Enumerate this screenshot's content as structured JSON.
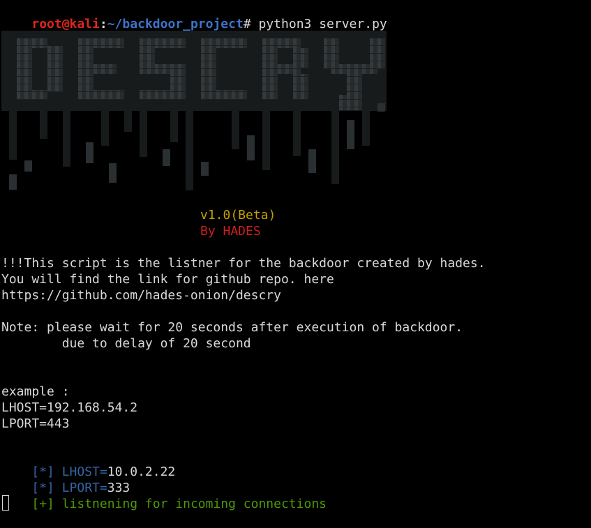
{
  "prompt": {
    "user_host": "root@kali",
    "separator": ":",
    "path": "~/backdoor_project",
    "symbol": "#",
    "command": " python3 server.py"
  },
  "banner": {
    "logo_text": "DESCRY",
    "version": "v1.0(Beta)",
    "author": "By HADES"
  },
  "intro": {
    "line1": "!!!This script is the listner for the backdoor created by hades.",
    "line2": "You will find the link for github repo. here",
    "line3": "https://github.com/hades-onion/descry"
  },
  "note": {
    "line1": "Note: please wait for 20 seconds after execution of backdoor.",
    "line2": "        due to delay of 20 second"
  },
  "example": {
    "header": "example :",
    "lhost": "LHOST=192.168.54.2",
    "lport": "LPORT=443"
  },
  "status": {
    "lhost_marker": "[*]",
    "lhost_key": " LHOST=",
    "lhost_value": "10.0.2.22",
    "lport_marker": "[*]",
    "lport_key": " LPORT=",
    "lport_value": "333",
    "listen_marker": "[+]",
    "listen_text": " listnening for incoming connections"
  },
  "colors": {
    "background": "#000000",
    "text": "#d9d9d9",
    "prompt_user": "#e0271c",
    "prompt_path": "#3e74c8",
    "version": "#c4a000",
    "author": "#cc1f1f",
    "info": "#3465a4",
    "success": "#4e9a06",
    "logo": "#2f3537"
  }
}
